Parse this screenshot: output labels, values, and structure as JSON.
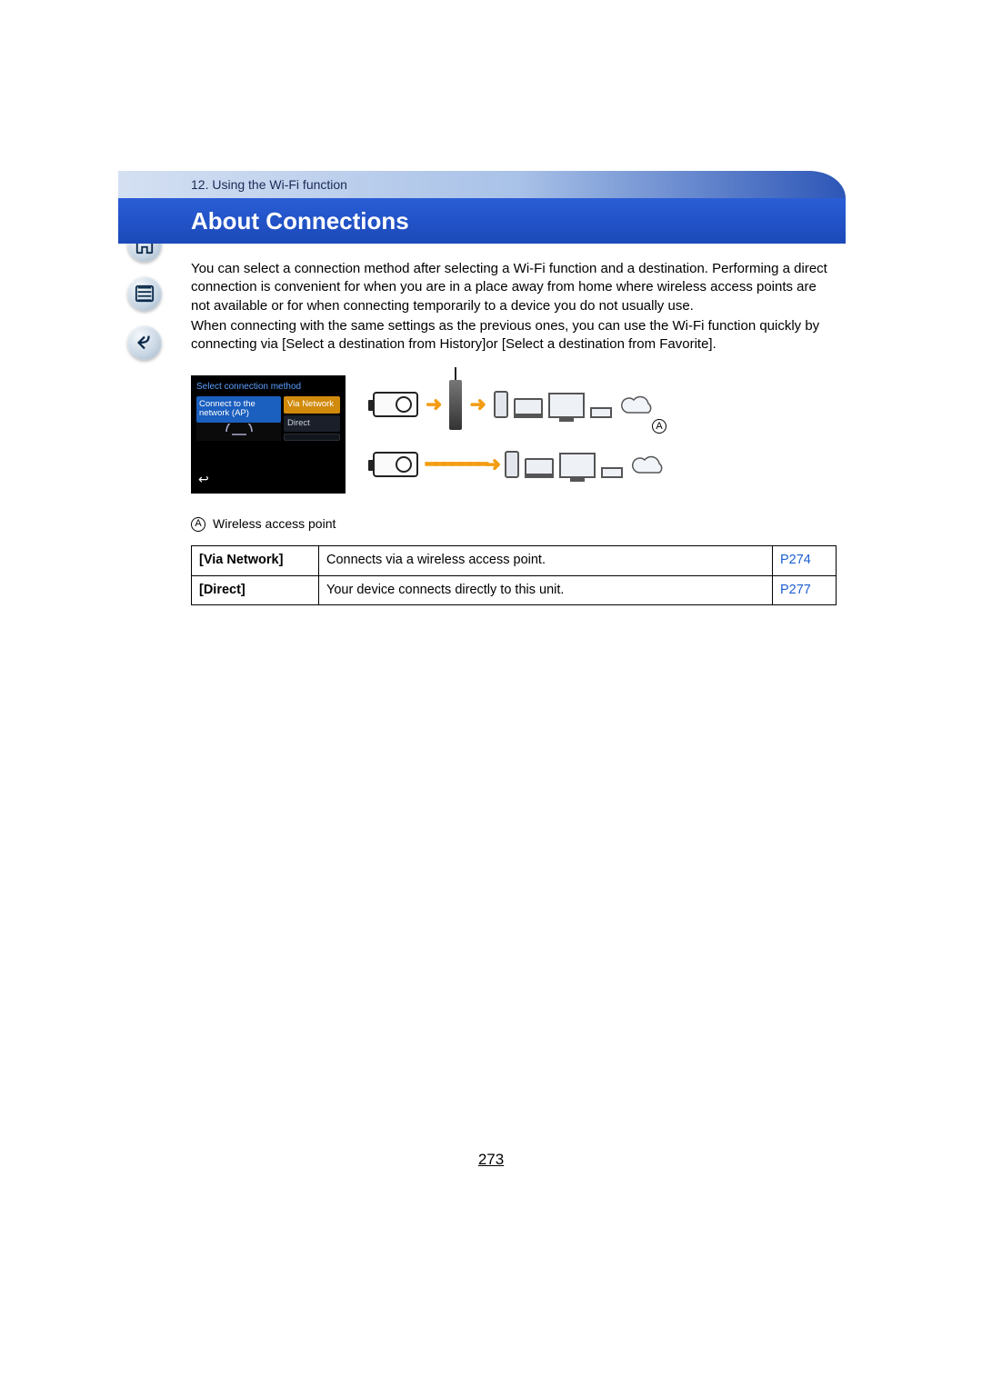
{
  "sidebar": {
    "home_label": "home",
    "toc_label": "table-of-contents",
    "back_label": "back"
  },
  "header": {
    "chapter": "12. Using the Wi-Fi function",
    "title": "About Connections"
  },
  "body": {
    "para1": "You can select a connection method after selecting a Wi-Fi function and a destination. Performing a direct connection is convenient for when you are in a place away from home where wireless access points are not available or for when connecting temporarily to a device you do not usually use.",
    "para2": "When connecting with the same settings as the previous ones, you can use the Wi-Fi function quickly by connecting via [Select a destination from History]or [Select a destination from Favorite]."
  },
  "menu_screen": {
    "title": "Select connection method",
    "option_left": "Connect to the network (AP)",
    "option_via": "Via Network",
    "option_direct": "Direct",
    "back_icon": "↩"
  },
  "diagram": {
    "marker": "A",
    "caption_marker": "A",
    "caption_text": "Wireless access point"
  },
  "table": {
    "rows": [
      {
        "name": "[Via Network]",
        "desc": "Connects via a wireless access point.",
        "link": "P274"
      },
      {
        "name": "[Direct]",
        "desc": "Your device connects directly to this unit.",
        "link": "P277"
      }
    ]
  },
  "page_number": "273"
}
